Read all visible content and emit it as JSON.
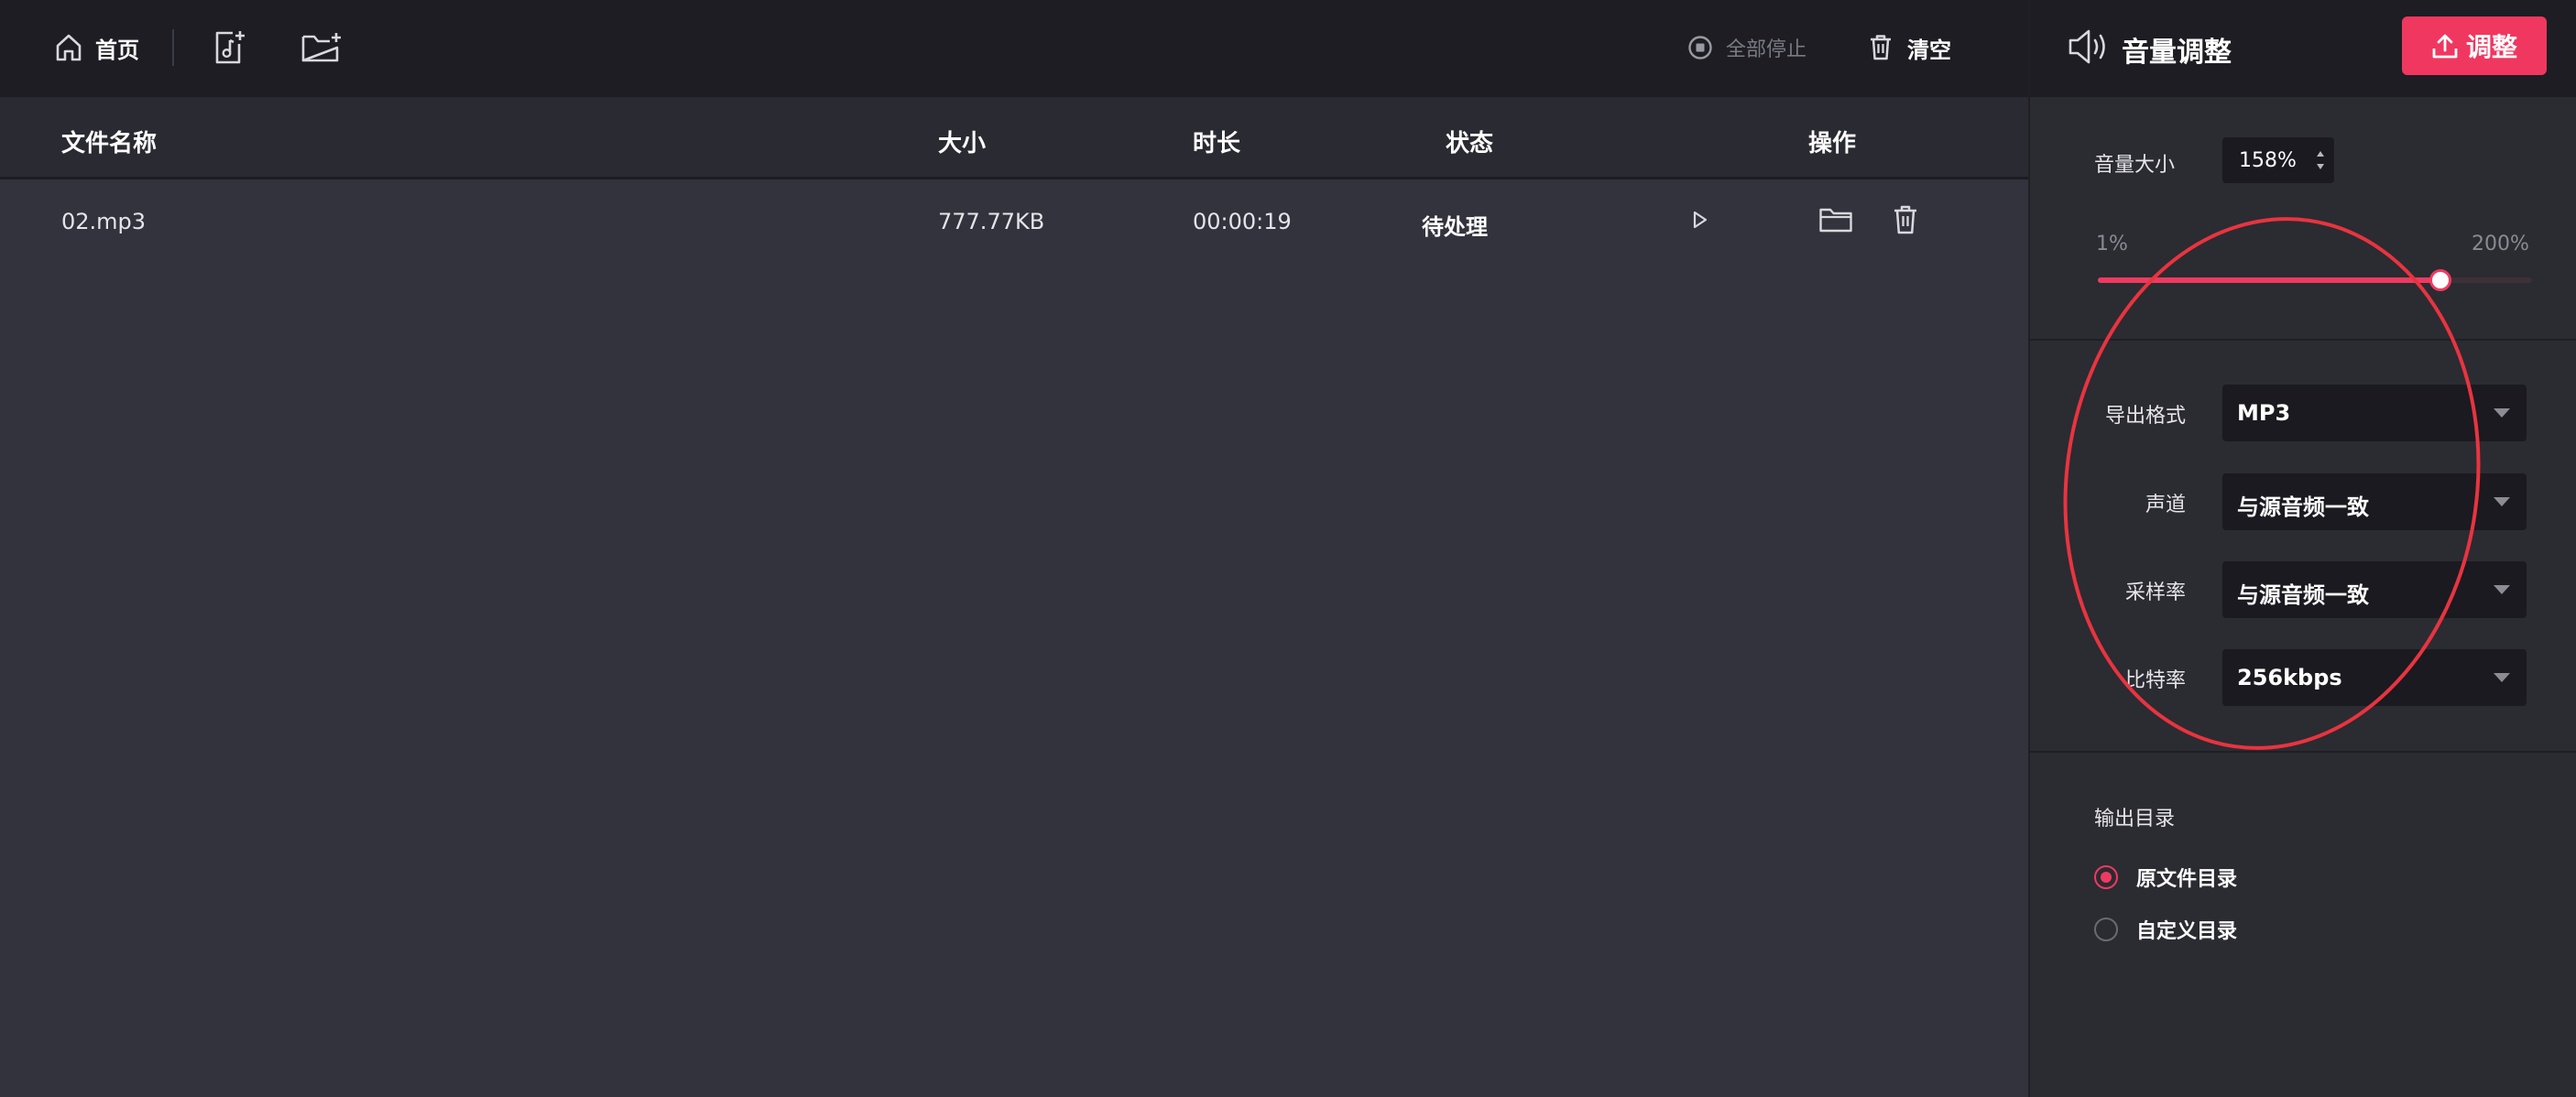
{
  "toolbar": {
    "home_label": "首页",
    "stop_all_label": "全部停止",
    "clear_label": "清空"
  },
  "table": {
    "columns": {
      "name": "文件名称",
      "size": "大小",
      "duration": "时长",
      "status": "状态",
      "actions": "操作"
    },
    "rows": [
      {
        "name": "02.mp3",
        "size": "777.77KB",
        "duration": "00:00:19",
        "status": "待处理"
      }
    ]
  },
  "panel": {
    "title": "音量调整",
    "adjust_button": "调整",
    "volume": {
      "label": "音量大小",
      "value": "158%",
      "min_label": "1%",
      "max_label": "200%",
      "level_fraction": 0.79
    },
    "fields": {
      "format": {
        "label": "导出格式",
        "value": "MP3"
      },
      "channel": {
        "label": "声道",
        "value": "与源音频一致"
      },
      "sample_rate": {
        "label": "采样率",
        "value": "与源音频一致"
      },
      "bitrate": {
        "label": "比特率",
        "value": "256kbps"
      }
    },
    "output_dir": {
      "label": "输出目录",
      "options": [
        {
          "label": "原文件目录",
          "selected": true
        },
        {
          "label": "自定义目录",
          "selected": false
        }
      ]
    }
  },
  "colors": {
    "accent": "#f0375f",
    "toolbar_bg": "#1d1d23",
    "main_bg": "#33333d",
    "annotation": "#e8343f"
  }
}
